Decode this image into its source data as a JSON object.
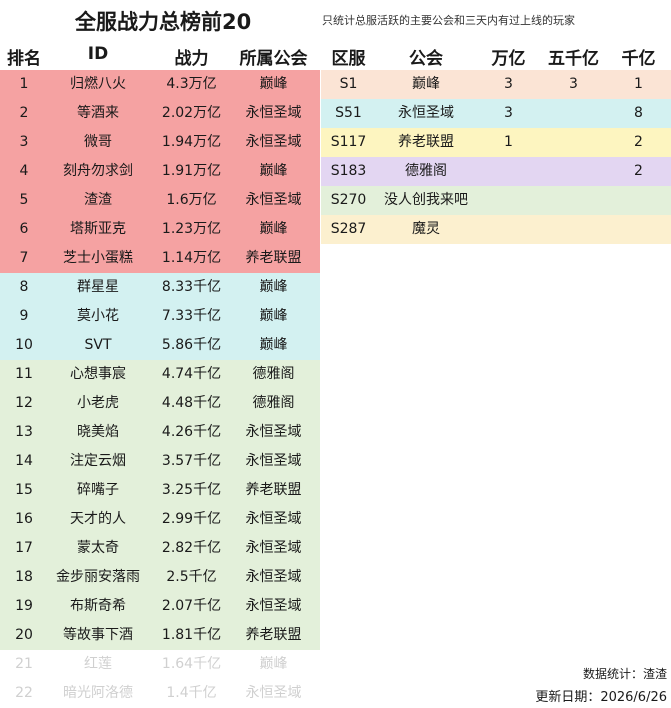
{
  "title": "全服战力总榜前20",
  "note": "只统计总服活跃的主要公会和三天内有过上线的玩家",
  "rank_headers": [
    "排名",
    "ID",
    "战力",
    "所属公会"
  ],
  "server_headers": [
    "区服",
    "公会",
    "万亿",
    "五千亿",
    "千亿"
  ],
  "colors": {
    "red": "#f5a2a2",
    "cyan": "#d3f1f1",
    "green": "#e3f0da",
    "faded_text": "#d0d0d0",
    "peach": "#fbe4d5",
    "yellow": "#fdf5c0",
    "lavender": "#e3d6f2",
    "cream": "#fcf0cf"
  },
  "rankings": [
    {
      "rank": "1",
      "id": "归燃八火",
      "power": "4.3万亿",
      "guild": "巅峰",
      "tier": "red"
    },
    {
      "rank": "2",
      "id": "等酒来",
      "power": "2.02万亿",
      "guild": "永恒圣域",
      "tier": "red"
    },
    {
      "rank": "3",
      "id": "微哥",
      "power": "1.94万亿",
      "guild": "永恒圣域",
      "tier": "red"
    },
    {
      "rank": "4",
      "id": "刻舟勿求剑",
      "power": "1.91万亿",
      "guild": "巅峰",
      "tier": "red"
    },
    {
      "rank": "5",
      "id": "渣渣",
      "power": "1.6万亿",
      "guild": "永恒圣域",
      "tier": "red"
    },
    {
      "rank": "6",
      "id": "塔斯亚克",
      "power": "1.23万亿",
      "guild": "巅峰",
      "tier": "red"
    },
    {
      "rank": "7",
      "id": "芝士小蛋糕",
      "power": "1.14万亿",
      "guild": "养老联盟",
      "tier": "red"
    },
    {
      "rank": "8",
      "id": "群星星",
      "power": "8.33千亿",
      "guild": "巅峰",
      "tier": "cyan"
    },
    {
      "rank": "9",
      "id": "莫小花",
      "power": "7.33千亿",
      "guild": "巅峰",
      "tier": "cyan"
    },
    {
      "rank": "10",
      "id": "SVT",
      "power": "5.86千亿",
      "guild": "巅峰",
      "tier": "cyan"
    },
    {
      "rank": "11",
      "id": "心想事宸",
      "power": "4.74千亿",
      "guild": "德雅阁",
      "tier": "green"
    },
    {
      "rank": "12",
      "id": "小老虎",
      "power": "4.48千亿",
      "guild": "德雅阁",
      "tier": "green"
    },
    {
      "rank": "13",
      "id": "晓美焰",
      "power": "4.26千亿",
      "guild": "永恒圣域",
      "tier": "green"
    },
    {
      "rank": "14",
      "id": "注定云烟",
      "power": "3.57千亿",
      "guild": "永恒圣域",
      "tier": "green"
    },
    {
      "rank": "15",
      "id": "碎嘴子",
      "power": "3.25千亿",
      "guild": "养老联盟",
      "tier": "green"
    },
    {
      "rank": "16",
      "id": "天才的人",
      "power": "2.99千亿",
      "guild": "永恒圣域",
      "tier": "green"
    },
    {
      "rank": "17",
      "id": "蒙太奇",
      "power": "2.82千亿",
      "guild": "永恒圣域",
      "tier": "green"
    },
    {
      "rank": "18",
      "id": "金步丽安落雨",
      "power": "2.5千亿",
      "guild": "永恒圣域",
      "tier": "green"
    },
    {
      "rank": "19",
      "id": "布斯奇希",
      "power": "2.07千亿",
      "guild": "永恒圣域",
      "tier": "green"
    },
    {
      "rank": "20",
      "id": "等故事下酒",
      "power": "1.81千亿",
      "guild": "养老联盟",
      "tier": "green"
    },
    {
      "rank": "21",
      "id": "红莲",
      "power": "1.64千亿",
      "guild": "巅峰",
      "tier": "faded"
    },
    {
      "rank": "22",
      "id": "暗光阿洛德",
      "power": "1.4千亿",
      "guild": "永恒圣域",
      "tier": "faded"
    }
  ],
  "servers": [
    {
      "server": "S1",
      "guild": "巅峰",
      "wan": "3",
      "wuqian": "3",
      "qian": "1",
      "color": "peach"
    },
    {
      "server": "S51",
      "guild": "永恒圣域",
      "wan": "3",
      "wuqian": "",
      "qian": "8",
      "color": "cyan"
    },
    {
      "server": "S117",
      "guild": "养老联盟",
      "wan": "1",
      "wuqian": "",
      "qian": "2",
      "color": "yellow"
    },
    {
      "server": "S183",
      "guild": "德雅阁",
      "wan": "",
      "wuqian": "",
      "qian": "2",
      "color": "lavender"
    },
    {
      "server": "S270",
      "guild": "没人创我来吧",
      "wan": "",
      "wuqian": "",
      "qian": "",
      "color": "green"
    },
    {
      "server": "S287",
      "guild": "魔灵",
      "wan": "",
      "wuqian": "",
      "qian": "",
      "color": "cream"
    }
  ],
  "footer": {
    "stats": "数据统计：渣渣",
    "update": "更新日期：2026/6/26"
  }
}
